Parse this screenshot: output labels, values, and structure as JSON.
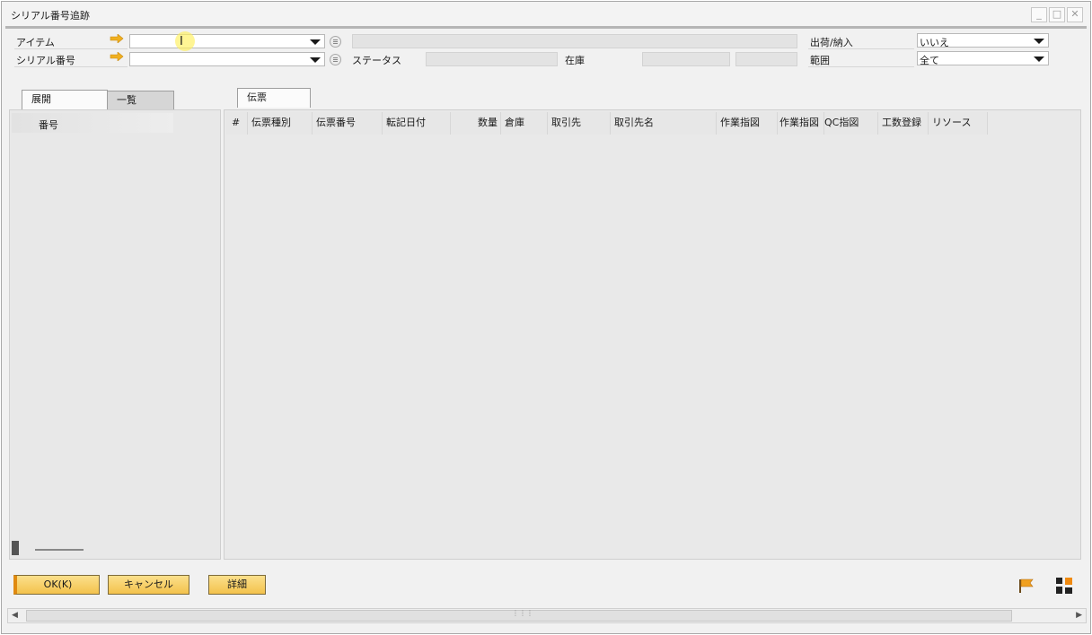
{
  "window": {
    "title": "シリアル番号追跡",
    "min": "_",
    "max": "□",
    "close": "✕"
  },
  "form": {
    "item_label": "アイテム",
    "serial_label": "シリアル番号",
    "status_label": "ステータス",
    "stock_label": "在庫",
    "ship_label": "出荷/納入",
    "ship_value": "いいえ",
    "range_label": "範囲",
    "range_value": "全て"
  },
  "left_tabs": [
    "展開",
    "一覧"
  ],
  "left_column": "番号",
  "right_tabs": [
    "伝票"
  ],
  "columns": [
    "#",
    "伝票種別",
    "伝票番号",
    "転記日付",
    "数量",
    "倉庫",
    "取引先",
    "取引先名",
    "作業指図",
    "作業指図",
    "QC指図",
    "工数登録",
    "リソース"
  ],
  "buttons": {
    "ok": "OK(K)",
    "cancel": "キャンセル",
    "detail": "詳細"
  },
  "colors": {
    "accent_yellow": "#f3c24c",
    "arrow_orange": "#f0b020"
  }
}
